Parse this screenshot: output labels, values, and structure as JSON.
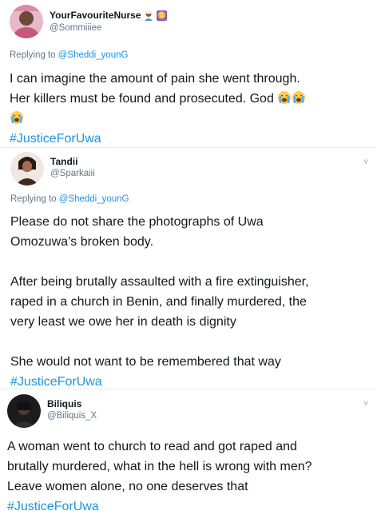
{
  "tweets": [
    {
      "display_name": "YourFavouriteNurse",
      "handle": "@Sommiiiee",
      "icons": [
        "nurse-emoji-icon",
        "gemini-sign-icon"
      ],
      "gemini_glyph": "♊",
      "replying_prefix": "Replying to ",
      "replying_to": "@Sheddi_younG",
      "lines": [
        "I can imagine the amount of pain she went through.",
        "Her killers must be found and prosecuted. God"
      ],
      "hashtag": "#JusticeForUwa"
    },
    {
      "display_name": "Tandii",
      "handle": "@Sparkaiii",
      "replying_prefix": "Replying to ",
      "replying_to": "@Sheddi_younG",
      "chevron": "˅",
      "lines": [
        "Please do not share the photographs of Uwa",
        "Omozuwa’s broken body.",
        "After being brutally assaulted with a fire extinguisher,",
        "raped in a church in Benin, and finally murdered, the",
        "very least we owe her in death is dignity",
        "She would not want to be remembered that way"
      ],
      "hashtag": "#JusticeForUwa"
    },
    {
      "display_name": "Biliquis",
      "handle": "@Biliquis_X",
      "chevron": "˅",
      "lines": [
        "A woman went to church to read and got raped and",
        "brutally murdered, what in the hell is wrong with men?",
        "Leave women alone, no one deserves that"
      ],
      "hashtag": "#JusticeForUwa"
    }
  ],
  "colors": {
    "link": "#1b95e0",
    "secondary_text": "#657786",
    "divider": "#e6ecf0"
  }
}
